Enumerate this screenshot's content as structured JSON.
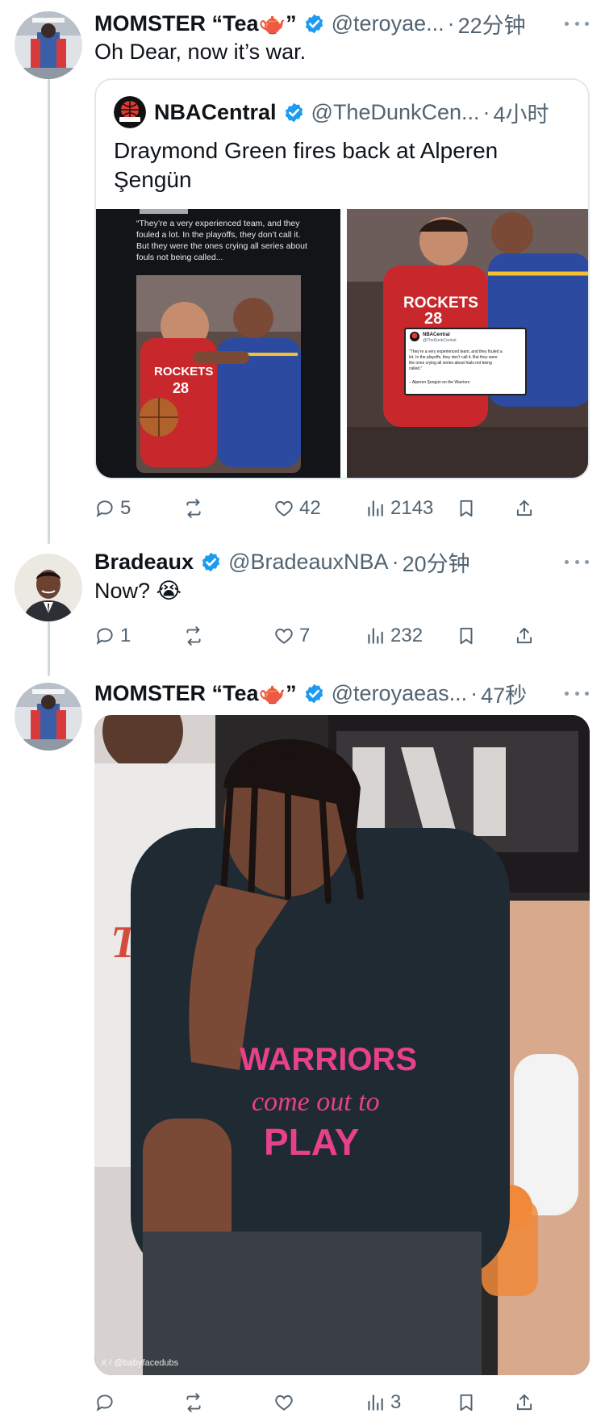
{
  "tweets": [
    {
      "name": "MOMSTER “Tea🫖”",
      "handle": "@teroyae...",
      "time": "22分钟",
      "text": "Oh Dear, now it’s war.",
      "quote": {
        "name": "NBACentral",
        "handle": "@TheDunkCen...",
        "time": "4小时",
        "text": "Draymond Green fires back at Alperen Şengün",
        "left_image": {
          "caption_lines": [
            "“They’re a very experienced team, and they",
            "fouled a lot. In the playoffs, they don’t call it.",
            "But they were the ones crying all series about",
            "fouls not being called..."
          ],
          "jersey_text": "ROCKETS",
          "jersey_number": "28"
        },
        "right_image": {
          "jersey_text": "ROCKETS",
          "jersey_number": "28",
          "card_name": "NBACentral",
          "card_handle": "@TheDunkCentral",
          "card_lines": [
            "“They’re a very experienced team, and they fouled a",
            "lot. In the playoffs, they don’t call it. But they were",
            "the ones crying all series about fouls not being",
            "called.”"
          ],
          "card_attribution": "– Alperen Şengün on the Warriors"
        }
      },
      "actions": {
        "reply": "5",
        "retweet": "",
        "like": "42",
        "views": "2143"
      }
    },
    {
      "name": "Bradeaux",
      "handle": "@BradeauxNBA",
      "time": "20分钟",
      "text": "Now? 😭",
      "actions": {
        "reply": "1",
        "retweet": "",
        "like": "7",
        "views": "232"
      }
    },
    {
      "name": "MOMSTER “Tea🫖”",
      "handle": "@teroyaeas...",
      "time": "47秒",
      "photo": {
        "shirt_lines": [
          "WARRIORS",
          "come out to",
          "PLAY"
        ],
        "watermark": "X / @babyfacedubs"
      },
      "actions": {
        "reply": "",
        "retweet": "",
        "like": "",
        "views": "3"
      }
    }
  ],
  "separator": "·",
  "colors": {
    "verified": "#1d9bf0",
    "secondary_text": "#536471",
    "border": "#e1e8ed",
    "thread_line": "#cfd9de"
  }
}
